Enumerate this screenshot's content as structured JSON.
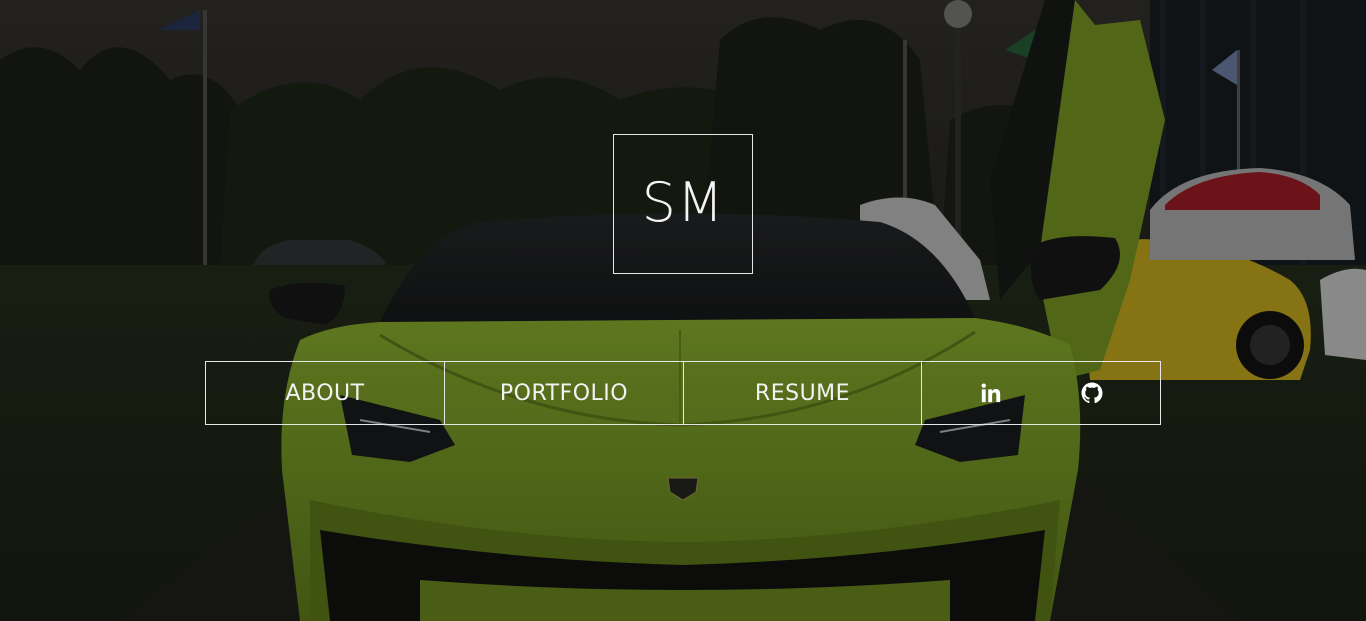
{
  "logo": {
    "text": "SM"
  },
  "nav": {
    "items": [
      {
        "label": "ABOUT"
      },
      {
        "label": "PORTFOLIO"
      },
      {
        "label": "RESUME"
      }
    ],
    "social": [
      {
        "icon": "linkedin-icon"
      },
      {
        "icon": "github-icon"
      }
    ]
  },
  "colors": {
    "text": "#f2f2f2",
    "border": "#e6e6e6",
    "car": "#8db52a"
  }
}
